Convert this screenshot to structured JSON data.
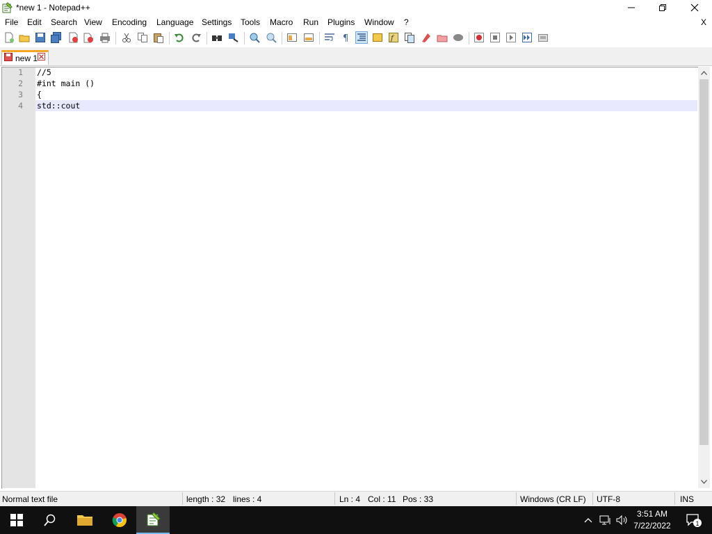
{
  "window": {
    "title": "*new 1 - Notepad++",
    "doc_close": "X"
  },
  "menu": [
    "File",
    "Edit",
    "Search",
    "View",
    "Encoding",
    "Language",
    "Settings",
    "Tools",
    "Macro",
    "Run",
    "Plugins",
    "Window",
    "?"
  ],
  "toolbar_icons": [
    "new-file-icon",
    "open-file-icon",
    "save-icon",
    "save-all-icon",
    "close-icon",
    "close-all-icon",
    "print-icon",
    "cut-icon",
    "copy-icon",
    "paste-icon",
    "undo-icon",
    "redo-icon",
    "find-icon",
    "replace-icon",
    "zoom-in-icon",
    "zoom-out-icon",
    "sync-vertical-icon",
    "sync-horizontal-icon",
    "word-wrap-icon",
    "show-all-chars-icon",
    "indent-guide-icon",
    "doc-map-icon",
    "function-list-icon",
    "doc-list-icon",
    "folder-as-workspace-icon",
    "monitoring-icon",
    "record-macro-icon",
    "stop-record-icon",
    "play-macro-icon",
    "run-macro-multiple-icon",
    "save-macro-icon"
  ],
  "tab": {
    "label": "new 1",
    "accent": "#f5a623"
  },
  "editor": {
    "line_numbers": [
      "1",
      "2",
      "3",
      "4"
    ],
    "lines": [
      "//5",
      "#int main ()",
      "{",
      "std::cout"
    ],
    "current_line": 4
  },
  "status": {
    "file_type": "Normal text file",
    "length": "length : 32",
    "lines": "lines : 4",
    "ln": "Ln : 4",
    "col": "Col : 11",
    "pos": "Pos : 33",
    "eol": "Windows (CR LF)",
    "encoding": "UTF-8",
    "mode": "INS"
  },
  "taskbar": {
    "time": "3:51 AM",
    "date": "7/22/2022",
    "notification_count": "1"
  }
}
